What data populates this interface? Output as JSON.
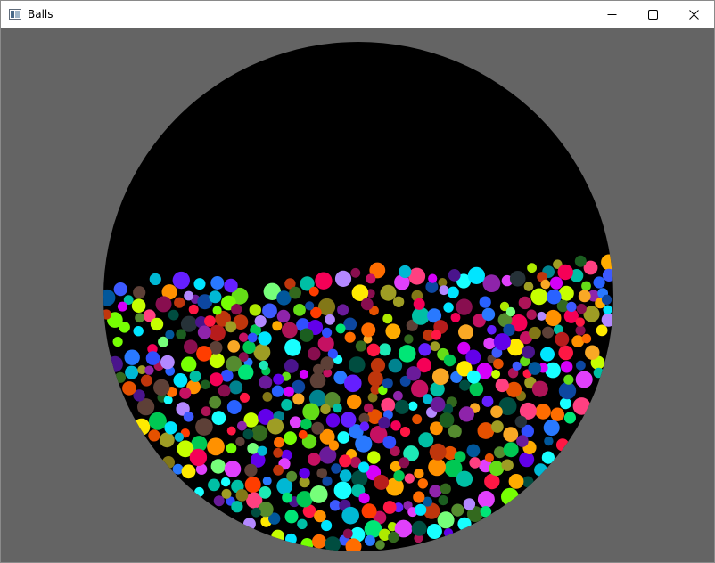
{
  "window": {
    "title": "Balls",
    "controls": {
      "minimize_icon": "minimize-icon",
      "maximize_icon": "maximize-icon",
      "close_icon": "close-icon"
    }
  },
  "scene": {
    "background_color": "#646464",
    "container_color": "#000000",
    "ball_colors": [
      "#ff1744",
      "#00e5ff",
      "#76ff03",
      "#d500f9",
      "#ffea00",
      "#2962ff",
      "#00c853",
      "#ff6d00",
      "#c51162",
      "#64dd17",
      "#6200ea",
      "#00b8d4",
      "#aeea00",
      "#f50057",
      "#1de9b6",
      "#3d5afe",
      "#ffab00",
      "#8e24aa",
      "#00bfa5",
      "#ff3d00",
      "#304ffe",
      "#76ff7a",
      "#b388ff",
      "#18ffff",
      "#ff4081",
      "#c6ff00",
      "#651fff",
      "#00e676",
      "#ff9100",
      "#2979ff",
      "#e040fb",
      "#1b5e20",
      "#4a148c",
      "#b71c1c",
      "#0d47a1",
      "#33691e",
      "#880e4f",
      "#004d40",
      "#bf360c",
      "#263238",
      "#827717",
      "#e65100",
      "#01579b",
      "#ad1457",
      "#558b2f",
      "#6a1b9a",
      "#f9a825",
      "#00838f",
      "#5d4037",
      "#9e9d24"
    ]
  }
}
